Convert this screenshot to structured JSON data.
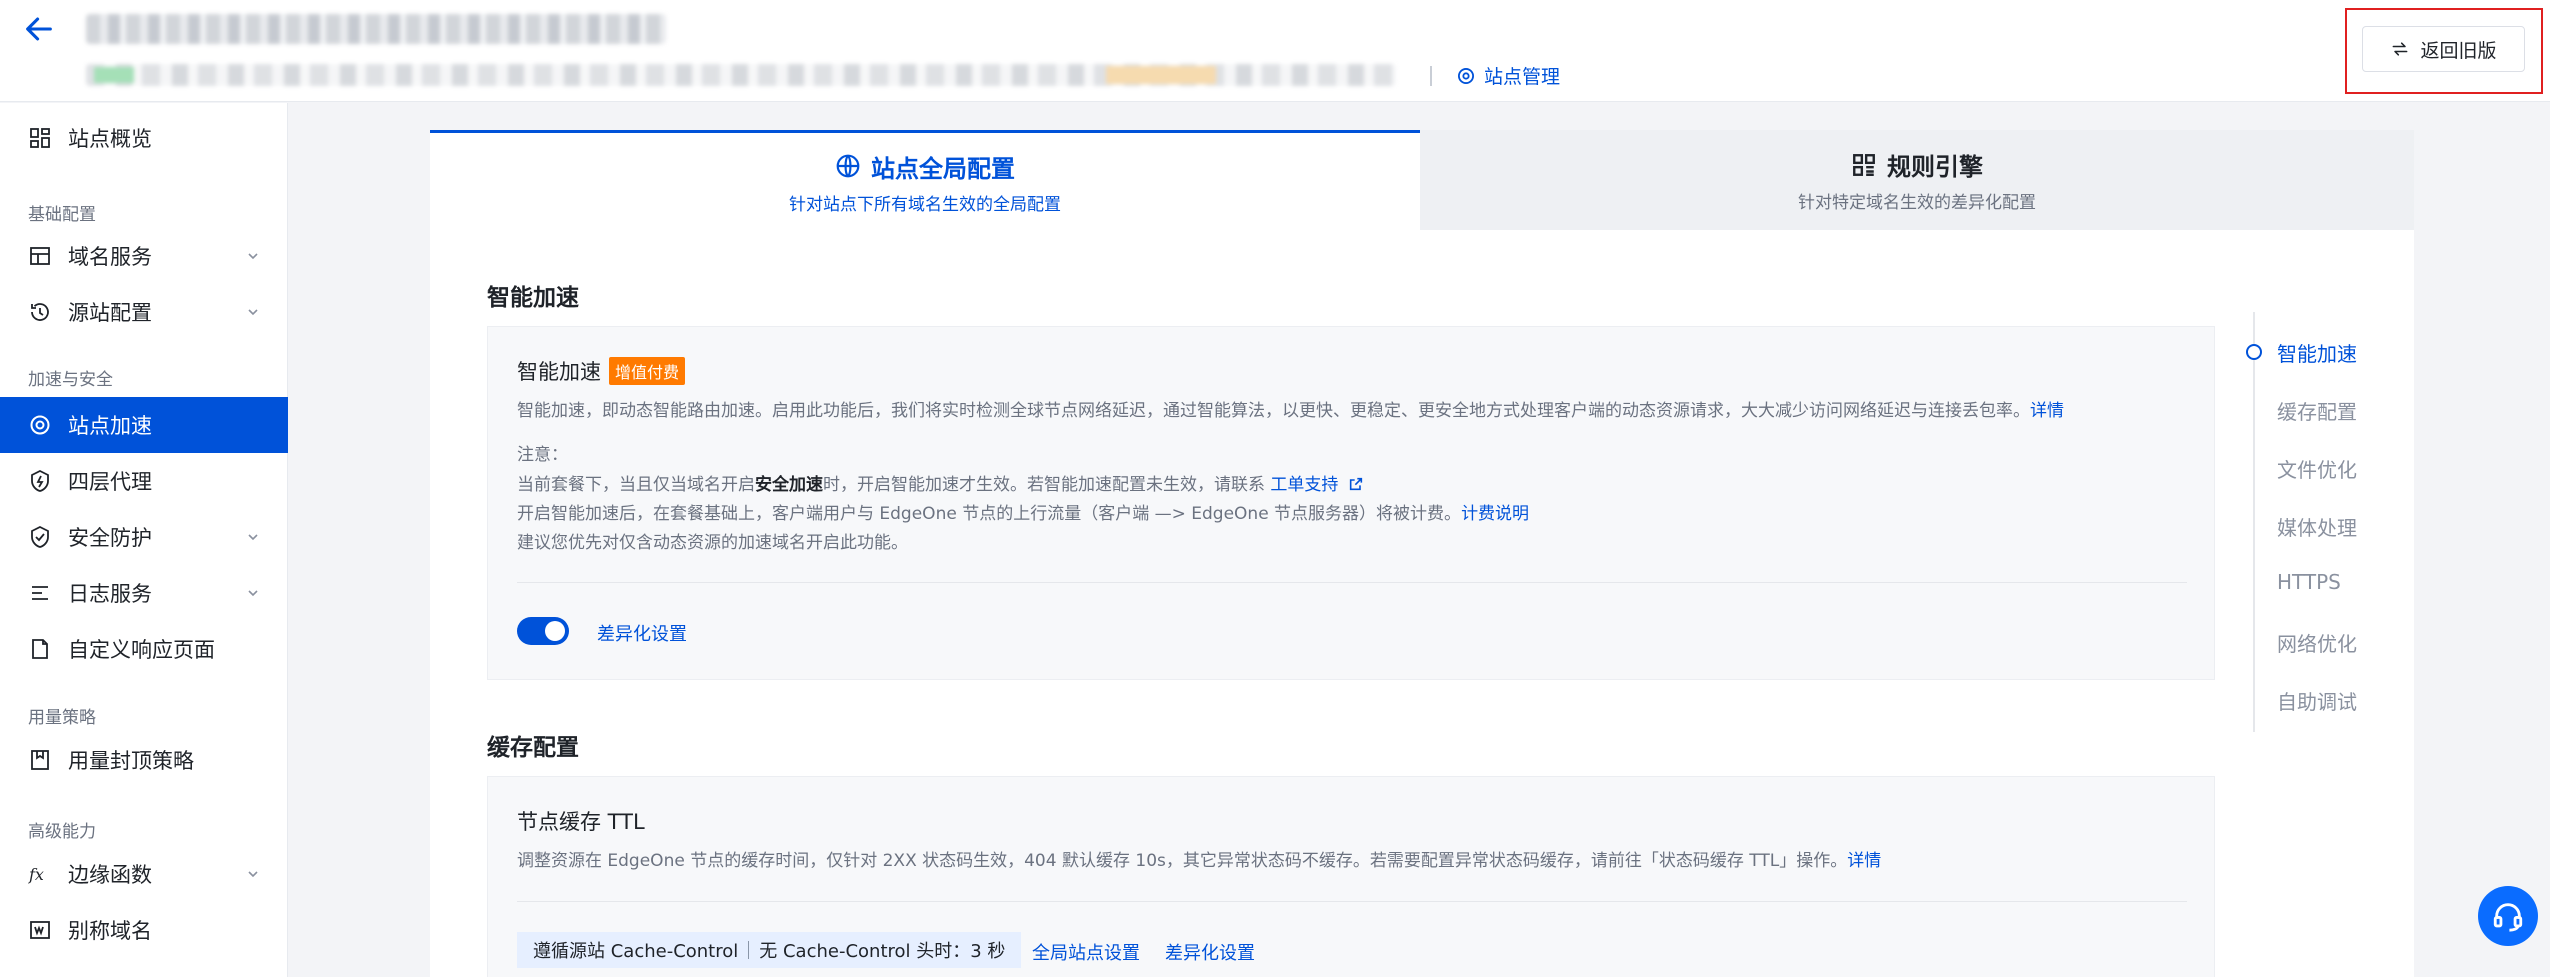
{
  "header": {
    "site_mgmt_label": "站点管理",
    "return_label": "返回旧版"
  },
  "sidebar": {
    "items": [
      {
        "label": "站点概览"
      },
      {
        "group": "基础配置"
      },
      {
        "label": "域名服务"
      },
      {
        "label": "源站配置"
      },
      {
        "group": "加速与安全"
      },
      {
        "label": "站点加速"
      },
      {
        "label": "四层代理"
      },
      {
        "label": "安全防护"
      },
      {
        "label": "日志服务"
      },
      {
        "label": "自定义响应页面"
      },
      {
        "group": "用量策略"
      },
      {
        "label": "用量封顶策略"
      },
      {
        "group": "高级能力"
      },
      {
        "label": "边缘函数"
      },
      {
        "label": "别称域名"
      }
    ],
    "active": "站点加速"
  },
  "tabs": {
    "global": {
      "title": "站点全局配置",
      "desc": "针对站点下所有域名生效的全局配置"
    },
    "rules": {
      "title": "规则引擎",
      "desc": "针对特定域名生效的差异化配置"
    }
  },
  "smart": {
    "section_title": "智能加速",
    "feature_title": "智能加速",
    "badge": "增值付费",
    "desc": "智能加速，即动态智能路由加速。启用此功能后，我们将实时检测全球节点网络延迟，通过智能算法，以更快、更稳定、更安全地方式处理客户端的动态资源请求，大大减少访问网络延迟与连接丢包率。",
    "desc_link": "详情",
    "note_title": "注意：",
    "note1_a": "当前套餐下，当且仅当域名开启",
    "note1_b": "安全加速",
    "note1_c": "时，开启智能加速才生效。若智能加速配置未生效，请联系 ",
    "note1_link": "工单支持",
    "note2": "开启智能加速后，在套餐基础上，客户端用户与 EdgeOne 节点的上行流量（客户端 —> EdgeOne 节点服务器）将被计费。",
    "note2_link": "计费说明",
    "note3": "建议您优先对仅含动态资源的加速域名开启此功能。",
    "toggle_on": true,
    "diff_link": "差异化设置"
  },
  "cache": {
    "section_title": "缓存配置",
    "feature_title": "节点缓存 TTL",
    "desc": "调整资源在 EdgeOne 节点的缓存时间，仅针对 2XX 状态码生效，404 默认缓存 10s，其它异常状态码不缓存。若需要配置异常状态码缓存，请前往「状态码缓存 TTL」操作。",
    "desc_link": "详情",
    "chip_a": "遵循源站 Cache-Control",
    "chip_b": "无 Cache-Control 头时：3 秒",
    "global_link": "全局站点设置",
    "diff_link": "差异化设置"
  },
  "anchors": [
    "智能加速",
    "缓存配置",
    "文件优化",
    "媒体处理",
    "HTTPS",
    "网络优化",
    "自助调试"
  ],
  "colors": {
    "primary": "#0052d9",
    "badge": "#ff7a00",
    "highlight_border": "#e02020"
  }
}
